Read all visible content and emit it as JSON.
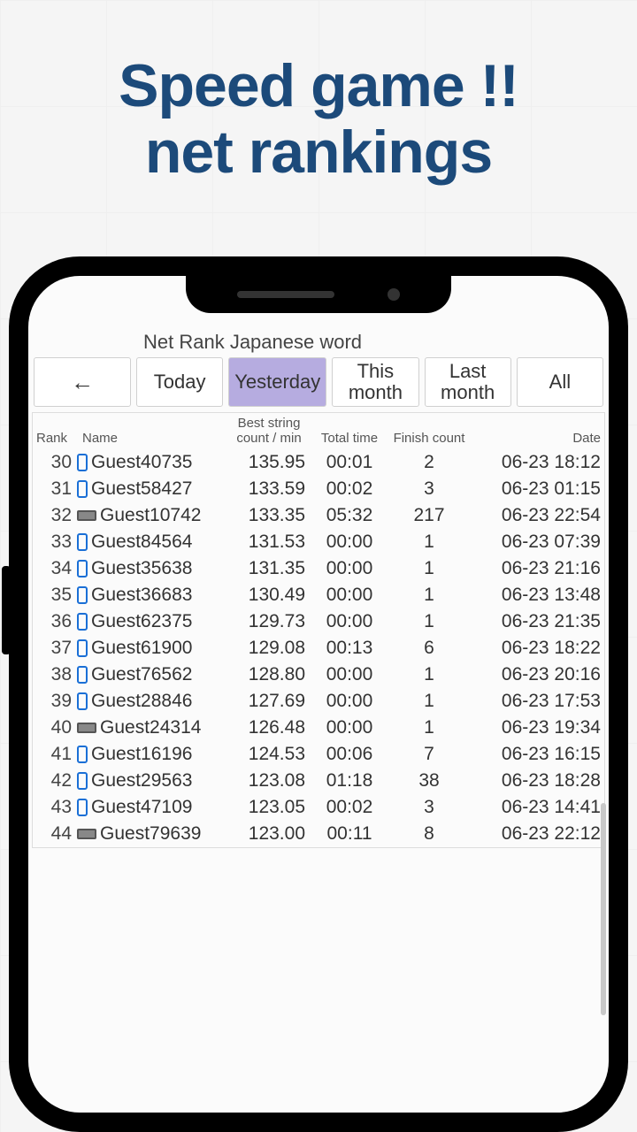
{
  "headline": {
    "line1": "Speed game !!",
    "line2": "net rankings"
  },
  "page_title": "Net Rank Japanese word",
  "back_arrow": "←",
  "tabs": [
    {
      "label": "Today",
      "active": false
    },
    {
      "label": "Yesterday",
      "active": true
    },
    {
      "label": "This month",
      "active": false
    },
    {
      "label": "Last month",
      "active": false
    },
    {
      "label": "All",
      "active": false
    }
  ],
  "columns": {
    "rank": "Rank",
    "name": "Name",
    "best": "Best string count / min",
    "total_time": "Total time",
    "finish": "Finish count",
    "date": "Date"
  },
  "rows": [
    {
      "rank": 30,
      "icon": "phone",
      "name": "Guest40735",
      "best": "135.95",
      "time": "00:01",
      "finish": 2,
      "date": "06-23 18:12"
    },
    {
      "rank": 31,
      "icon": "phone",
      "name": "Guest58427",
      "best": "133.59",
      "time": "00:02",
      "finish": 3,
      "date": "06-23 01:15"
    },
    {
      "rank": 32,
      "icon": "wide",
      "name": "Guest10742",
      "best": "133.35",
      "time": "05:32",
      "finish": 217,
      "date": "06-23 22:54"
    },
    {
      "rank": 33,
      "icon": "phone",
      "name": "Guest84564",
      "best": "131.53",
      "time": "00:00",
      "finish": 1,
      "date": "06-23 07:39"
    },
    {
      "rank": 34,
      "icon": "phone",
      "name": "Guest35638",
      "best": "131.35",
      "time": "00:00",
      "finish": 1,
      "date": "06-23 21:16"
    },
    {
      "rank": 35,
      "icon": "phone",
      "name": "Guest36683",
      "best": "130.49",
      "time": "00:00",
      "finish": 1,
      "date": "06-23 13:48"
    },
    {
      "rank": 36,
      "icon": "phone",
      "name": "Guest62375",
      "best": "129.73",
      "time": "00:00",
      "finish": 1,
      "date": "06-23 21:35"
    },
    {
      "rank": 37,
      "icon": "phone",
      "name": "Guest61900",
      "best": "129.08",
      "time": "00:13",
      "finish": 6,
      "date": "06-23 18:22"
    },
    {
      "rank": 38,
      "icon": "phone",
      "name": "Guest76562",
      "best": "128.80",
      "time": "00:00",
      "finish": 1,
      "date": "06-23 20:16"
    },
    {
      "rank": 39,
      "icon": "phone",
      "name": "Guest28846",
      "best": "127.69",
      "time": "00:00",
      "finish": 1,
      "date": "06-23 17:53"
    },
    {
      "rank": 40,
      "icon": "wide",
      "name": "Guest24314",
      "best": "126.48",
      "time": "00:00",
      "finish": 1,
      "date": "06-23 19:34"
    },
    {
      "rank": 41,
      "icon": "phone",
      "name": "Guest16196",
      "best": "124.53",
      "time": "00:06",
      "finish": 7,
      "date": "06-23 16:15"
    },
    {
      "rank": 42,
      "icon": "phone",
      "name": "Guest29563",
      "best": "123.08",
      "time": "01:18",
      "finish": 38,
      "date": "06-23 18:28"
    },
    {
      "rank": 43,
      "icon": "phone",
      "name": "Guest47109",
      "best": "123.05",
      "time": "00:02",
      "finish": 3,
      "date": "06-23 14:41"
    },
    {
      "rank": 44,
      "icon": "wide",
      "name": "Guest79639",
      "best": "123.00",
      "time": "00:11",
      "finish": 8,
      "date": "06-23 22:12"
    }
  ]
}
